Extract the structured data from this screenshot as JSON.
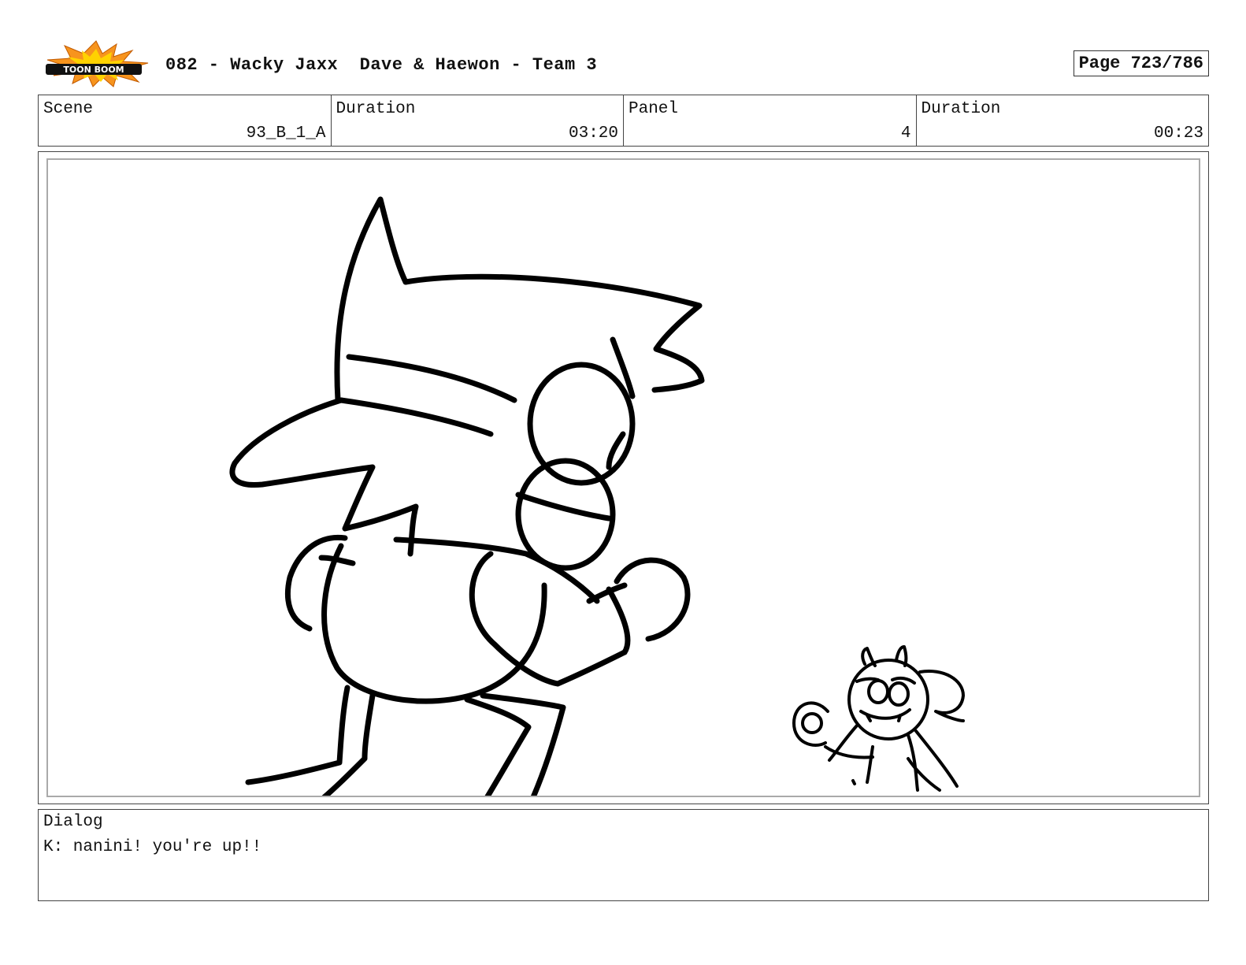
{
  "header": {
    "logo_text": "TOON BOOM",
    "title": "082 - Wacky Jaxx  Dave & Haewon - Team 3",
    "page": "Page 723/786"
  },
  "info": {
    "scene_label": "Scene",
    "scene_value": "93_B_1_A",
    "scene_duration_label": "Duration",
    "scene_duration_value": "03:20",
    "panel_label": "Panel",
    "panel_value": "4",
    "panel_duration_label": "Duration",
    "panel_duration_value": "00:23"
  },
  "dialog": {
    "label": "Dialog",
    "text": "K: nanini! you're up!!"
  },
  "colors": {
    "logo_burst": "#f7941d",
    "logo_burst_inner": "#ffd200",
    "sketch_line": "#000000"
  }
}
